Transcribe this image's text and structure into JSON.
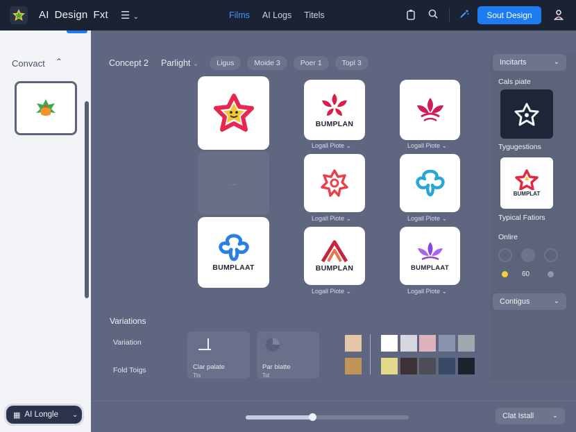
{
  "header": {
    "title_words": [
      "AI",
      "Design",
      "Fxt"
    ],
    "nav": [
      {
        "label": "Films",
        "active": true
      },
      {
        "label": "AI Logs",
        "active": false
      },
      {
        "label": "Titels",
        "active": false
      }
    ],
    "primary_button": "Sout Design"
  },
  "sidebar": {
    "section_title": "Convact",
    "footer_label": "AI Longle"
  },
  "filters": {
    "concept": "Concept 2",
    "sort": "Parlight",
    "chips": [
      "Ligus",
      "Moide 3",
      "Poer 1",
      "Topl 3"
    ]
  },
  "logos": {
    "brand_a": "BUMPLAN",
    "brand_b": "BUMPLAAT",
    "brand_c": "BUMPLAN",
    "brand_d": "BUMPLAT",
    "caption": "Logall Piote",
    "placeholder": "..."
  },
  "right_panel": {
    "dropdown1": "Incitarts",
    "label1": "Cals piate",
    "label2": "Tygugestions",
    "tile_brand": "BUMPLAT",
    "label3": "Typical Fatiors",
    "label4": "Onlire",
    "value": "60",
    "dropdown2": "Contigus"
  },
  "variations": {
    "title": "Variations",
    "row1": "Variation",
    "row2": "Fold Toigs",
    "card1": {
      "line1": "Clar palate",
      "line2": "Tts"
    },
    "card2": {
      "line1": "Par blatte",
      "line2": "Tst"
    }
  },
  "swatches": {
    "row1": [
      "#e8c6aa",
      "#ffffff",
      "#d6d8e1",
      "#dfb3bd",
      "#8a93ad",
      "#a2a6ad"
    ],
    "row2": [
      "#c49457",
      "#e1d98a",
      "#3d3235",
      "#4c4d55",
      "#3a4a66",
      "#1c2230"
    ]
  },
  "slider": {
    "value_fraction": 0.41
  },
  "bottom": {
    "button_label": "Clat Istall"
  },
  "colors": {
    "accent": "#1d7cf2",
    "topbar": "#1b2233"
  }
}
